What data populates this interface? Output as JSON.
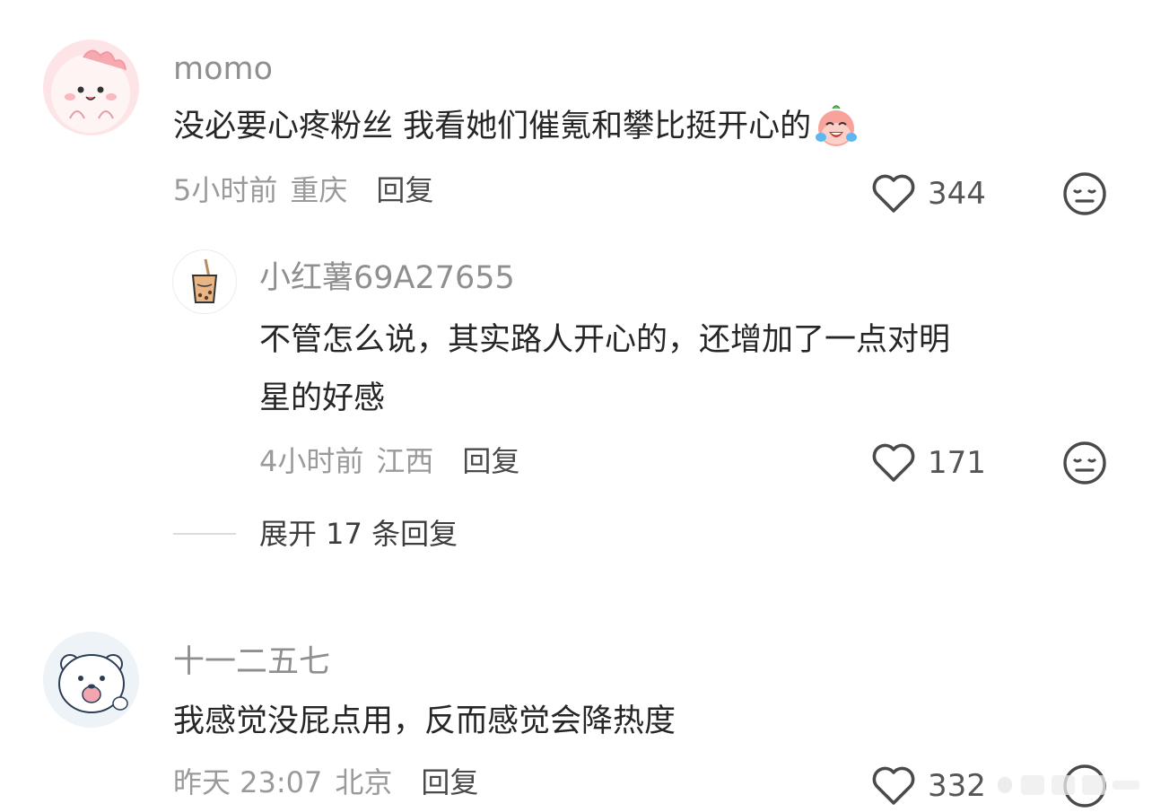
{
  "comments": [
    {
      "username": "momo",
      "text": "没必要心疼粉丝 我看她们催氪和攀比挺开心的",
      "time": "5小时前",
      "location": "重庆",
      "reply_label": "回复",
      "likes": "344",
      "avatar_icon": "pink-cartoon-avatar",
      "emoji_icon": "crying-laughing-sticker-icon"
    },
    {
      "username": "十一二五七",
      "text": "我感觉没屁点用，反而感觉会降热度",
      "time": "昨天 23:07",
      "location": "北京",
      "reply_label": "回复",
      "likes": "332",
      "avatar_icon": "polar-bear-avatar"
    }
  ],
  "reply": {
    "username": "小红薯69A27655",
    "text_line1": "不管怎么说，其实路人开心的，还增加了一点对明",
    "text_line2": "星的好感",
    "time": "4小时前",
    "location": "江西",
    "reply_label": "回复",
    "likes": "171",
    "avatar_icon": "bubble-tea-avatar"
  },
  "expand_replies": "展开 17 条回复",
  "watermark": "weibo-watermark",
  "colors": {
    "username": "#8f8f8f",
    "body": "#262626",
    "meta": "#9a9a9a",
    "icon": "#4a4a4a"
  }
}
